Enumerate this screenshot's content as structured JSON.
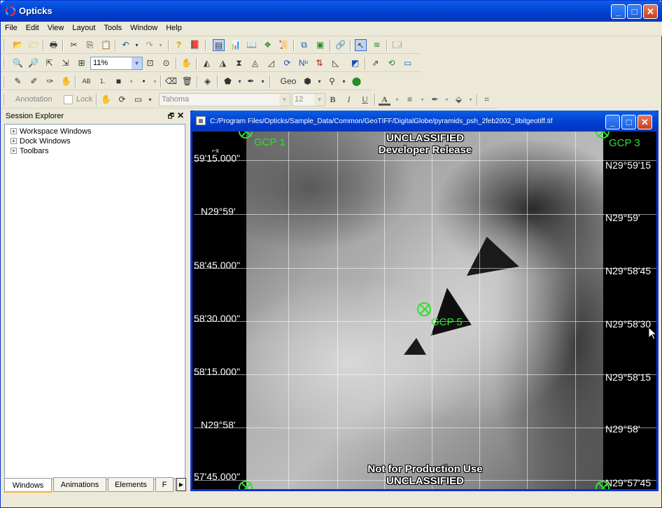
{
  "app": {
    "title": "Opticks"
  },
  "menu": [
    "File",
    "Edit",
    "View",
    "Layout",
    "Tools",
    "Window",
    "Help"
  ],
  "toolbar2": {
    "zoom": "11%"
  },
  "toolbar3": {
    "ab_label": "AB",
    "num_label": "1.",
    "geo_label": "Geo"
  },
  "annotation_bar": {
    "annotation_label": "Annotation",
    "lock_label": "Lock",
    "font": "Tahoma",
    "size": "12",
    "bold": "B",
    "italic": "I",
    "underline": "U",
    "text_color": "A"
  },
  "session_explorer": {
    "title": "Session Explorer",
    "nodes": [
      "Workspace Windows",
      "Dock Windows",
      "Toolbars"
    ],
    "tabs": [
      "Windows",
      "Animations",
      "Elements",
      "F"
    ]
  },
  "workspace": {
    "title": "C:/Program Files/Opticks/Sample_Data/Common/GeoTIFF/DigitalGlobe/pyramids_psh_2feb2002_8bitgeotiff.tif",
    "classification_top": [
      "UNCLASSIFIED",
      "Developer Release"
    ],
    "classification_bottom": [
      "Not for Production Use",
      "UNCLASSIFIED"
    ],
    "left_labels": [
      "59'15.000\"",
      "N29°59'",
      "58'45.000\"",
      "58'30.000\"",
      "58'15.000\"",
      "N29°58'",
      "57'45.000\""
    ],
    "right_labels": [
      "N29°59'15",
      "N29°59'",
      "N29°58'45",
      "N29°58'30",
      "N29°58'15",
      "N29°58'",
      "N29°57'45"
    ],
    "gcps": [
      "GCP 1",
      "GCP 3",
      "GCP 5"
    ]
  },
  "colors": {
    "xp_blue": "#0054e3",
    "gcp_green": "#2fe02f"
  }
}
